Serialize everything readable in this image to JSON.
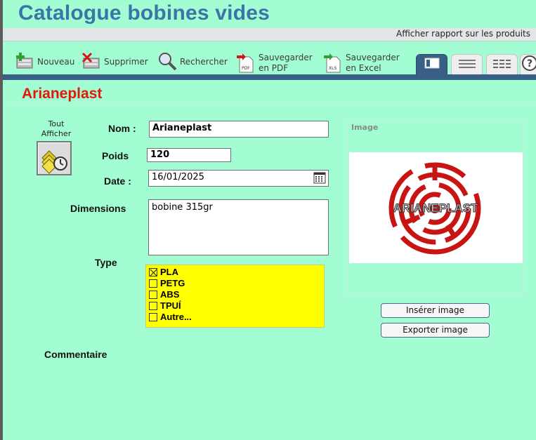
{
  "app": {
    "title": "Catalogue bobines vides",
    "report_link": "Afficher rapport sur les produits"
  },
  "toolbar": {
    "nouveau": "Nouveau",
    "supprimer": "Supprimer",
    "rechercher": "Rechercher",
    "pdf_line1": "Sauvegarder",
    "pdf_line2": "en PDF",
    "excel_line1": "Sauvegarder",
    "excel_line2": "en Excel",
    "pdf_badge": "PDF",
    "xls_badge": "XLS",
    "help": "?"
  },
  "record": {
    "title": "Arianeplast",
    "tout_afficher_1": "Tout",
    "tout_afficher_2": "Afficher"
  },
  "form": {
    "nom_label": "Nom :",
    "nom_value": "Arianeplast",
    "poids_label": "Poids",
    "poids_value": "120",
    "date_label": "Date :",
    "date_value": "16/01/2025",
    "dimensions_label": "Dimensions",
    "dimensions_value": "bobine 315gr",
    "type_label": "Type",
    "commentaire_label": "Commentaire"
  },
  "type_options": [
    {
      "label": "PLA",
      "checked": true
    },
    {
      "label": "PETG",
      "checked": false
    },
    {
      "label": "ABS",
      "checked": false
    },
    {
      "label": "TPUÍ",
      "checked": false
    },
    {
      "label": "Autre...",
      "checked": false
    }
  ],
  "image_panel": {
    "label": "Image",
    "logo_text": "ARIANEPLAST",
    "insert_button": "Insérer image",
    "export_button": "Exporter image"
  },
  "colors": {
    "background": "#a3fdd3",
    "title_blue": "#3a75a5",
    "record_red": "#e0190c",
    "type_yellow": "#ffff00",
    "tab_active": "#3a5f86"
  }
}
